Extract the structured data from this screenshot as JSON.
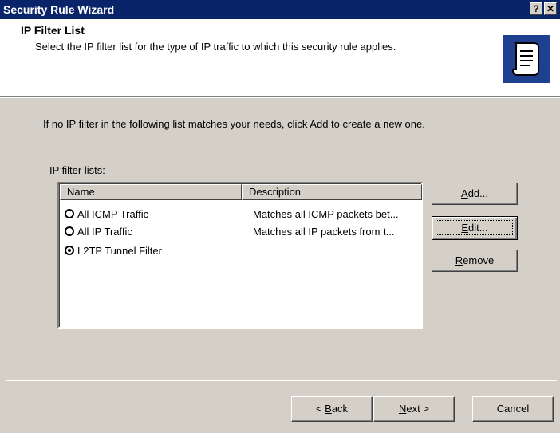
{
  "window": {
    "title": "Security Rule Wizard",
    "help_glyph": "?",
    "close_glyph": "✕"
  },
  "header": {
    "title": "IP Filter List",
    "subtitle": "Select the IP filter list for the type of IP traffic to which this security rule applies."
  },
  "body": {
    "intro": "If no IP filter in the following list matches your needs, click Add to create a new one."
  },
  "list": {
    "label_key": "I",
    "label_rest": "P filter lists:",
    "columns": [
      "Name",
      "Description"
    ],
    "rows": [
      {
        "name": "All ICMP Traffic",
        "description": "Matches all ICMP packets bet...",
        "selected": false
      },
      {
        "name": "All IP Traffic",
        "description": "Matches all IP packets from t...",
        "selected": false
      },
      {
        "name": "L2TP Tunnel Filter",
        "description": "",
        "selected": true
      }
    ]
  },
  "buttons": {
    "add_key": "A",
    "add_rest": "dd...",
    "edit_key": "E",
    "edit_rest": "dit...",
    "remove_key": "R",
    "remove_rest": "emove",
    "back_pre": "< ",
    "back_key": "B",
    "back_rest": "ack",
    "next_key": "N",
    "next_rest": "ext >",
    "cancel": "Cancel"
  },
  "colors": {
    "titlebar": "#0a246a",
    "dialog": "#d4d0c8"
  }
}
